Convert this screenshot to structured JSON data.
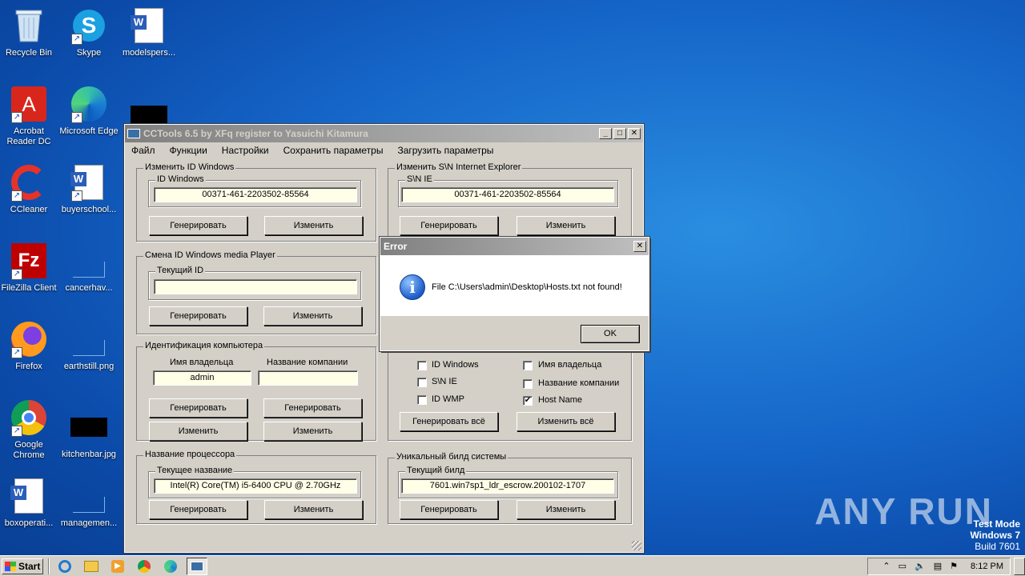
{
  "desktop": {
    "icons": [
      {
        "label": "Recycle Bin",
        "icon": "recycle-bin-icon"
      },
      {
        "label": "Skype",
        "icon": "skype-icon"
      },
      {
        "label": "modelspers...",
        "icon": "word-doc-icon"
      },
      {
        "label": "Acrobat Reader DC",
        "icon": "acrobat-icon"
      },
      {
        "label": "Microsoft Edge",
        "icon": "edge-icon"
      },
      {
        "label": "CCleaner",
        "icon": "ccleaner-icon"
      },
      {
        "label": "buyerschool...",
        "icon": "word-doc-icon"
      },
      {
        "label": "FileZilla Client",
        "icon": "filezilla-icon"
      },
      {
        "label": "cancerhav...",
        "icon": "file-icon"
      },
      {
        "label": "Firefox",
        "icon": "firefox-icon"
      },
      {
        "label": "earthstill.png",
        "icon": "image-icon"
      },
      {
        "label": "Google Chrome",
        "icon": "chrome-icon"
      },
      {
        "label": "kitchenbar.jpg",
        "icon": "image-icon"
      },
      {
        "label": "boxoperati...",
        "icon": "word-doc-icon"
      },
      {
        "label": "managemen...",
        "icon": "file-icon"
      }
    ]
  },
  "window": {
    "title": "CCTools 6.5 by XFq register to Yasuichi Kitamura",
    "menu": [
      "Файл",
      "Функции",
      "Настройки",
      "Сохранить параметры",
      "Загрузить параметры"
    ],
    "win_id": {
      "title": "Изменить ID Windows",
      "sub_label": "ID Windows",
      "value": "00371-461-2203502-85564",
      "generate": "Генерировать",
      "change": "Изменить"
    },
    "ie_sn": {
      "title": "Изменить S\\N Internet Explorer",
      "sub_label": "S\\N IE",
      "value": "00371-461-2203502-85564",
      "generate": "Генерировать",
      "change": "Изменить"
    },
    "wmp": {
      "title": "Смена ID Windows media Player",
      "sub_label": "Текущий ID",
      "value": "",
      "generate": "Генерировать",
      "change": "Изменить"
    },
    "computer": {
      "title": "Идентификация компьютера",
      "owner_label": "Имя владельца",
      "owner_value": "admin",
      "company_label": "Название компании",
      "company_value": "",
      "generate1": "Генерировать",
      "generate2": "Генерировать",
      "change1": "Изменить",
      "change2": "Изменить"
    },
    "checks": {
      "items": [
        {
          "label": "ID Windows",
          "checked": false
        },
        {
          "label": "S\\N IE",
          "checked": false
        },
        {
          "label": "ID WMP",
          "checked": false
        },
        {
          "label": "Имя владельца",
          "checked": false
        },
        {
          "label": "Название компании",
          "checked": false
        },
        {
          "label": "Host Name",
          "checked": true
        }
      ],
      "generate_all": "Генерировать всё",
      "change_all": "Изменить всё"
    },
    "cpu": {
      "title": "Название процессора",
      "sub_label": "Текущее название",
      "value": "Intel(R) Core(TM) i5-6400 CPU @ 2.70GHz",
      "generate": "Генерировать",
      "change": "Изменить"
    },
    "build": {
      "title": "Уникальный билд системы",
      "sub_label": "Текущий билд",
      "value": "7601.win7sp1_ldr_escrow.200102-1707",
      "generate": "Генерировать",
      "change": "Изменить"
    }
  },
  "dialog": {
    "title": "Error",
    "message": "File C:\\Users\\admin\\Desktop\\Hosts.txt not found!",
    "ok": "OK"
  },
  "taskbar": {
    "start": "Start",
    "time": "8:12 PM"
  },
  "watermark": "ANY RUN",
  "testmode": {
    "line1": "Test Mode",
    "line2": "Windows 7",
    "line3": "Build 7601"
  }
}
